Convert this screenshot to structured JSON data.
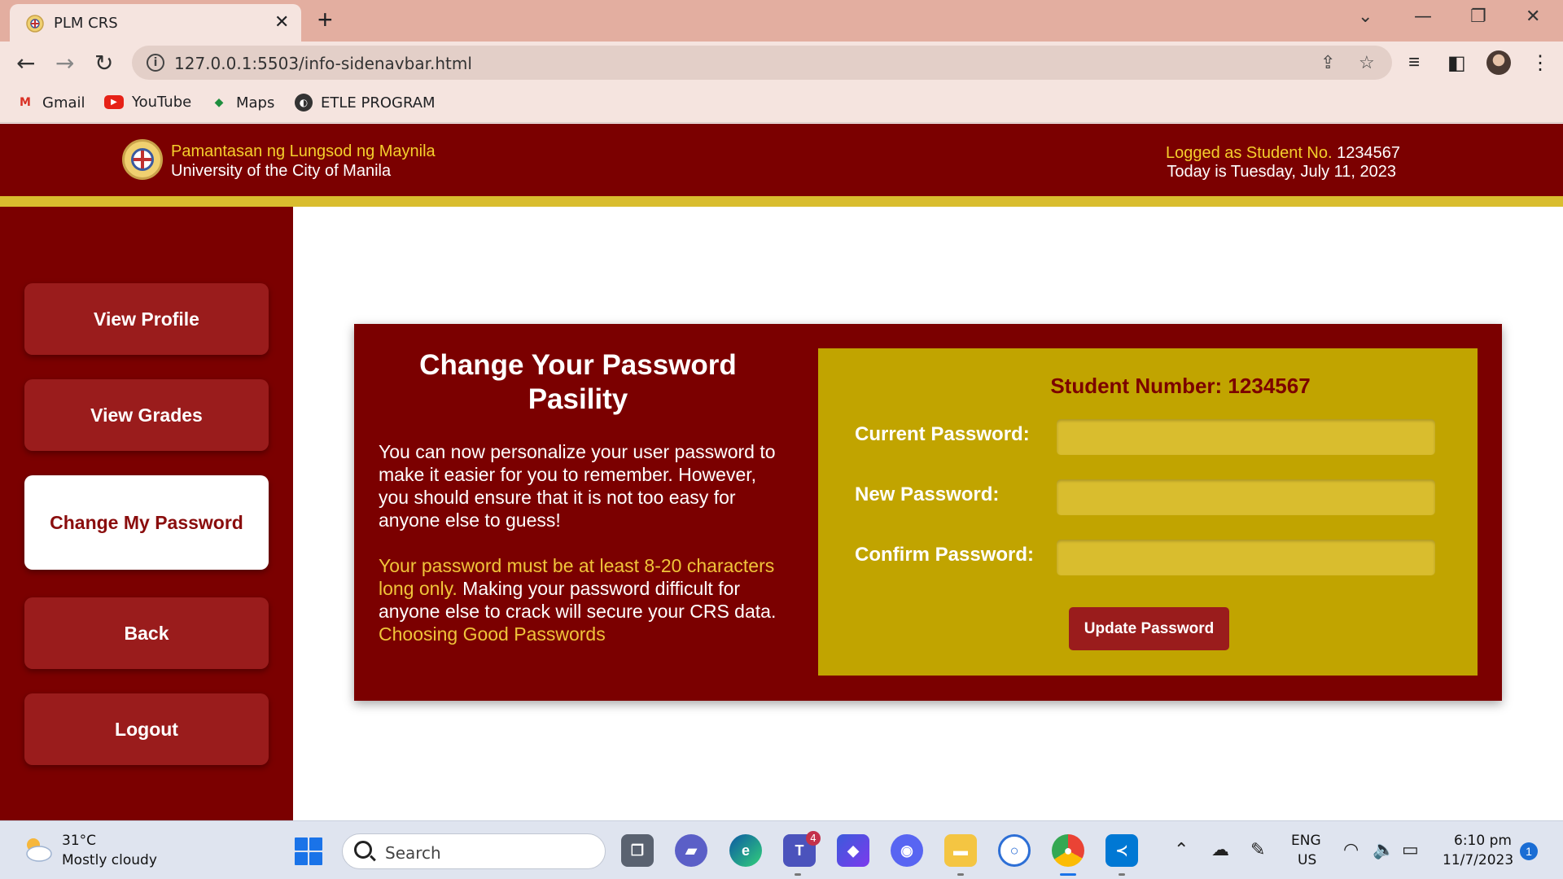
{
  "browser": {
    "tab_title": "PLM CRS",
    "url": "127.0.0.1:5503/info-sidenavbar.html",
    "bookmarks": [
      {
        "label": "Gmail",
        "icon": "gmail-icon"
      },
      {
        "label": "YouTube",
        "icon": "youtube-icon"
      },
      {
        "label": "Maps",
        "icon": "maps-icon"
      },
      {
        "label": "ETLE PROGRAM",
        "icon": "globe-icon"
      }
    ]
  },
  "header": {
    "university_name": "Pamantasan ng Lungsod ng Maynila",
    "university_subtitle": "University of the City of Manila",
    "logged_label": "Logged as Student No.",
    "student_no": "1234567",
    "today": "Today is Tuesday, July 11, 2023"
  },
  "sidebar": {
    "items": [
      {
        "label": "View Profile"
      },
      {
        "label": "View Grades"
      },
      {
        "label": "Change My Password"
      },
      {
        "label": "Back"
      },
      {
        "label": "Logout"
      }
    ]
  },
  "card": {
    "title": "Change Your Password Pasility",
    "paragraph1": "You can now personalize your user password to make it easier for you to remember. However, you should ensure that it is not too easy for anyone else to guess!",
    "paragraph2_highlight": "Your password must be at least 8-20 characters long only.",
    "paragraph2_text": " Making your password difficult for anyone else to crack will secure your CRS data. ",
    "paragraph2_link": "Choosing Good Passwords"
  },
  "form": {
    "student_number": "Student Number: 1234567",
    "current_password_label": "Current Password:",
    "new_password_label": "New Password:",
    "confirm_password_label": "Confirm Password:",
    "update_button": "Update Password"
  },
  "colors": {
    "maroon": "#7b0000",
    "button_red": "#9a1c1c",
    "gold": "#c1a400",
    "gold_input": "#d9bd2e",
    "gold_text": "#f0c43a"
  },
  "taskbar": {
    "temperature": "31°C",
    "weather": "Mostly cloudy",
    "search_placeholder": "Search",
    "language": "ENG",
    "region": "US",
    "time": "6:10 pm",
    "date": "11/7/2023",
    "notification_count": "1",
    "teams_badge": "4"
  }
}
